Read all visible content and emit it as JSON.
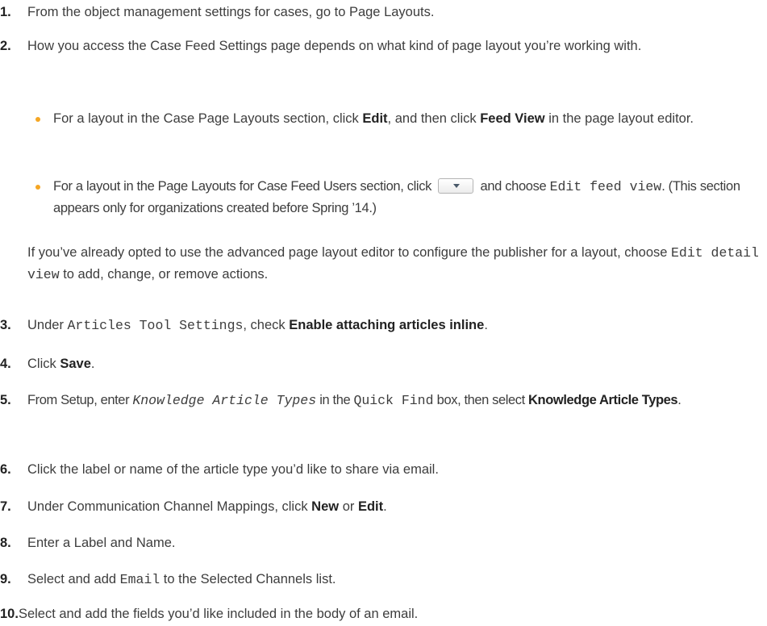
{
  "steps": [
    {
      "num": "1.",
      "t1": "From the object management settings for cases, go to Page Layouts."
    },
    {
      "num": "2.",
      "t1": "How you access the Case Feed Settings page depends on what kind of page layout you’re working with.",
      "bullets": [
        {
          "t1": "For a layout in the Case Page Layouts section, click ",
          "b1": "Edit",
          "t2": ", and then click ",
          "b2": "Feed View",
          "t3": " in the page layout editor."
        },
        {
          "t1": "For a layout in the Page Layouts for Case Feed Users section, click ",
          "t2": " and choose ",
          "c1": "Edit feed view",
          "t3": ". (This section appears only for organizations created before Spring ’14.)"
        }
      ],
      "p_t1": "If you’ve already opted to use the advanced page layout editor to configure the publisher for a layout, choose ",
      "p_c1": "Edit detail view",
      "p_t2": " to add, change, or remove actions."
    },
    {
      "num": "3.",
      "t1": "Under ",
      "c1": "Articles Tool Settings",
      "t2": ", check ",
      "b1": "Enable attaching articles inline",
      "t3": "."
    },
    {
      "num": "4.",
      "t1": "Click ",
      "b1": "Save",
      "t2": "."
    },
    {
      "num": "5.",
      "t1": "From Setup, enter ",
      "c1": "Knowledge Article Types",
      "t2": " in the ",
      "c2": "Quick Find",
      "t3": " box, then select ",
      "b1": "Knowledge Article Types",
      "t4": "."
    },
    {
      "num": "6.",
      "t1": "Click the label or name of the article type you’d like to share via email."
    },
    {
      "num": "7.",
      "t1": "Under Communication Channel Mappings, click ",
      "b1": "New",
      "t2": " or ",
      "b2": "Edit",
      "t3": "."
    },
    {
      "num": "8.",
      "t1": "Enter a Label and Name."
    },
    {
      "num": "9.",
      "t1": "Select and add ",
      "c1": "Email",
      "t2": " to the Selected Channels list."
    },
    {
      "num": "10.",
      "t1": "Select and add the fields you’d like included in the body of an email."
    }
  ]
}
